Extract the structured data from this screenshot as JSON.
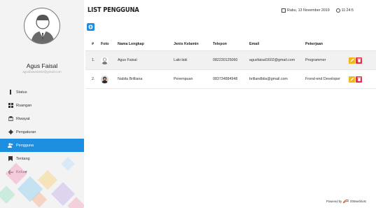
{
  "sidebar": {
    "profile": {
      "name": "Agus Faisal",
      "email": "agusfaisal1602@gmail.com"
    },
    "menu": [
      {
        "label": "Status",
        "icon": "status-icon",
        "active": false
      },
      {
        "label": "Ruangan",
        "icon": "grid-icon",
        "active": false
      },
      {
        "label": "Riwayat",
        "icon": "history-icon",
        "active": false
      },
      {
        "label": "Pengaturan",
        "icon": "gear-icon",
        "active": false
      },
      {
        "label": "Pengguna",
        "icon": "users-icon",
        "active": true
      },
      {
        "label": "Tentang",
        "icon": "bookmark-icon",
        "active": false
      },
      {
        "label": "Keluar",
        "icon": "logout-icon",
        "active": false
      }
    ]
  },
  "header": {
    "title": "LIST PENGGUNA",
    "date": "Rabu, 13 November 2019",
    "time": "11:24:5"
  },
  "table": {
    "columns": [
      "#",
      "Foto",
      "Nama Lengkap",
      "Jenis Kelamin",
      "Telepon",
      "Email",
      "Pekerjaan"
    ],
    "rows": [
      {
        "no": "1.",
        "nama": "Agus Faisal",
        "jenis_kelamin": "Laki-laki",
        "telepon": "082230125060",
        "email": "agusfaisal1602@gmail.com",
        "pekerjaan": "Programmer"
      },
      {
        "no": "2.",
        "nama": "Nabila Brilliana",
        "jenis_kelamin": "Perempuan",
        "telepon": "083734884948",
        "email": "brillandbila@gmail.com",
        "pekerjaan": "Frond-end Developer"
      }
    ]
  },
  "footer": {
    "prefix": "Powered by",
    "brand": "000webhost"
  },
  "colors": {
    "accent": "#1e8fe0",
    "edit": "#f0b81a",
    "delete": "#dc3545"
  }
}
